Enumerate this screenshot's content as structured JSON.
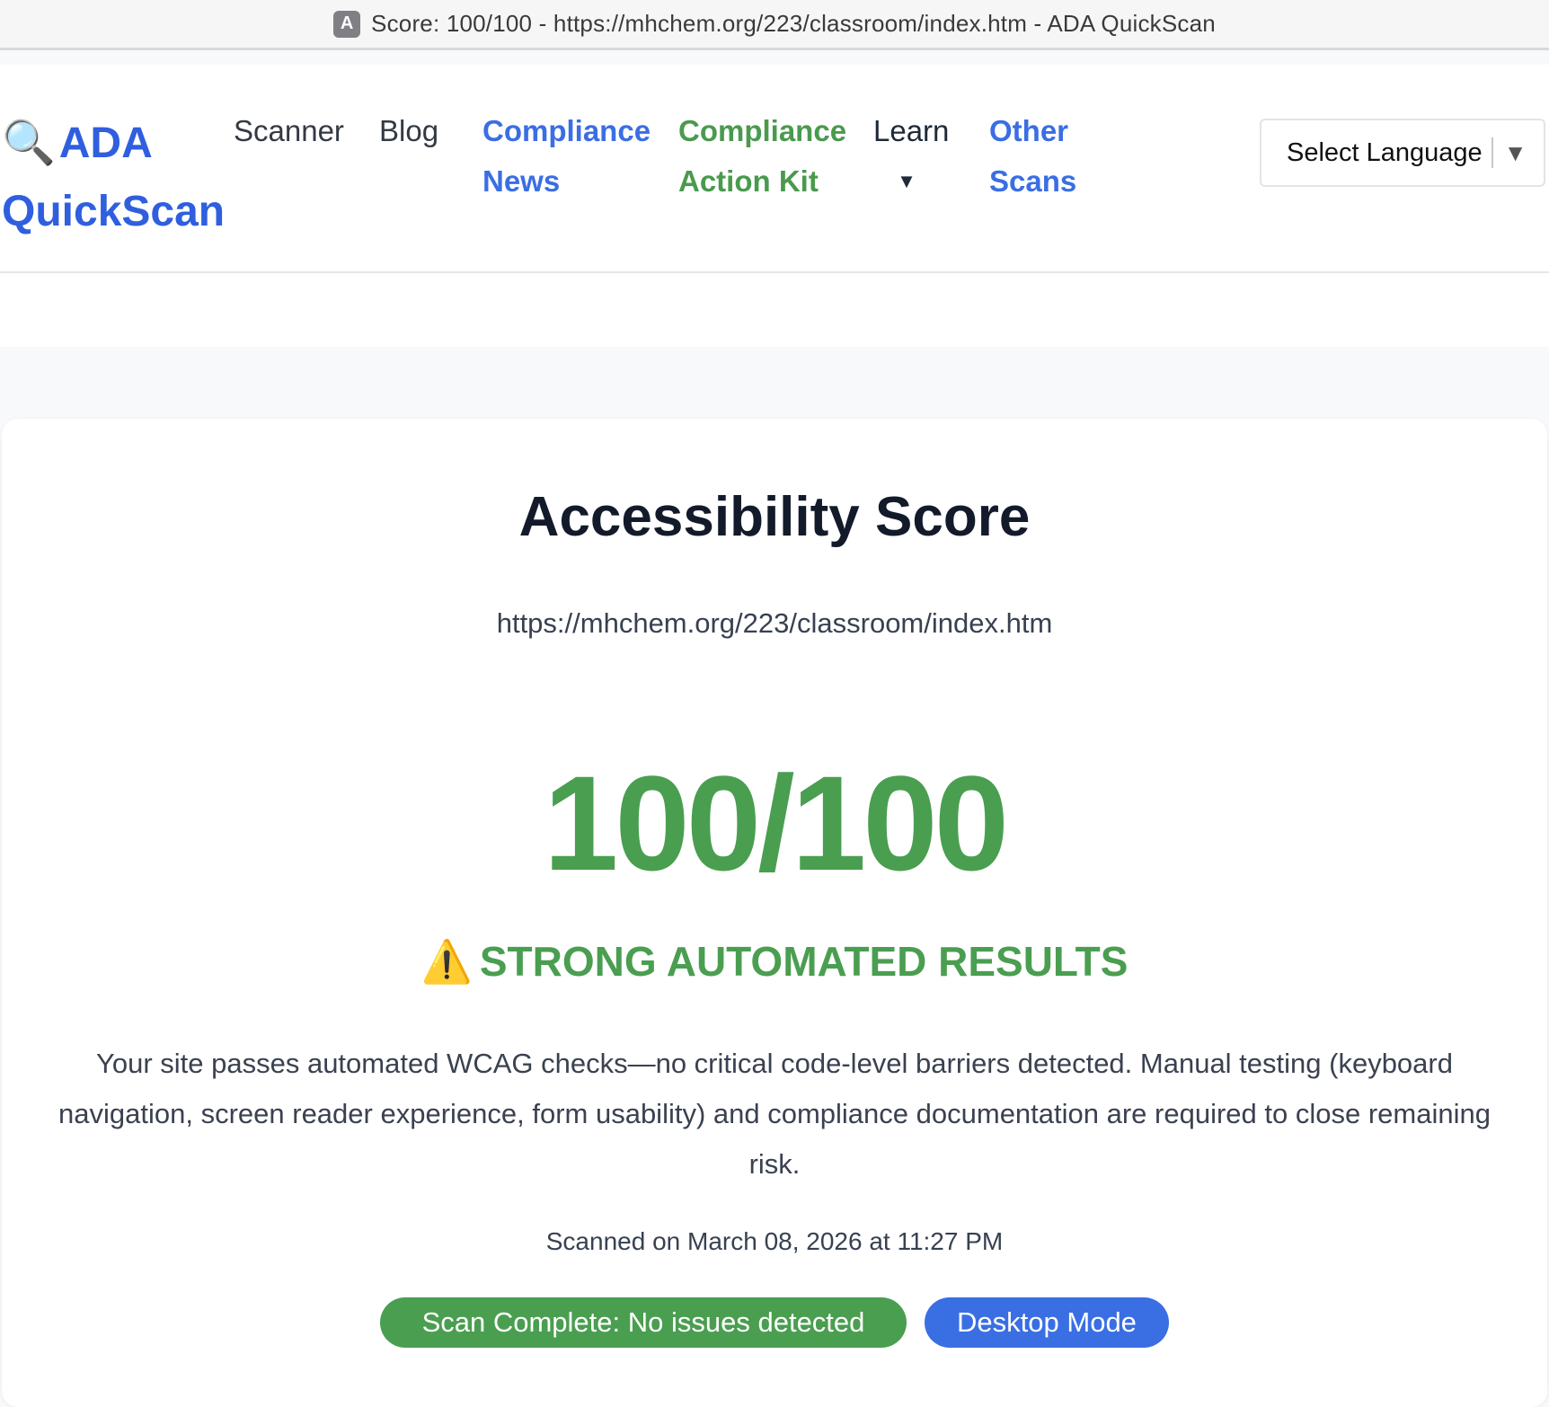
{
  "browser": {
    "favicon_letter": "A",
    "title": "Score: 100/100 - https://mhchem.org/223/classroom/index.htm - ADA QuickScan"
  },
  "header": {
    "logo_icon": "magnifier-icon",
    "logo_glyph": "🔍",
    "logo_line1": "ADA",
    "logo_line2": "QuickScan",
    "nav": {
      "scanner": "Scanner",
      "blog": "Blog",
      "compliance_news_1": "Compliance",
      "compliance_news_2": "News",
      "action_kit_1": "Compliance",
      "action_kit_2": "Action Kit",
      "learn": "Learn",
      "learn_caret": "▼",
      "other_scans_1": "Other",
      "other_scans_2": "Scans"
    },
    "language_select": {
      "selected": "Select Language",
      "arrow": "▼"
    }
  },
  "result": {
    "title": "Accessibility Score",
    "url": "https://mhchem.org/223/classroom/index.htm",
    "score": "100/100",
    "score_value": 100,
    "score_max": 100,
    "status_icon": "warning-icon",
    "status_glyph": "⚠️",
    "status_text": "STRONG AUTOMATED RESULTS",
    "description": "Your site passes automated WCAG checks—no critical code-level barriers detected. Manual testing (keyboard navigation, screen reader experience, form usability) and compliance documentation are required to close remaining risk.",
    "scanned": "Scanned on March 08, 2026 at 11:27 PM",
    "badges": {
      "complete": "Scan Complete: No issues detected",
      "mode": "Desktop Mode"
    }
  },
  "colors": {
    "brand_blue": "#2f5fde",
    "link_blue": "#3a6ee3",
    "success_green": "#4a9e50",
    "heading_dark": "#131a2a"
  }
}
